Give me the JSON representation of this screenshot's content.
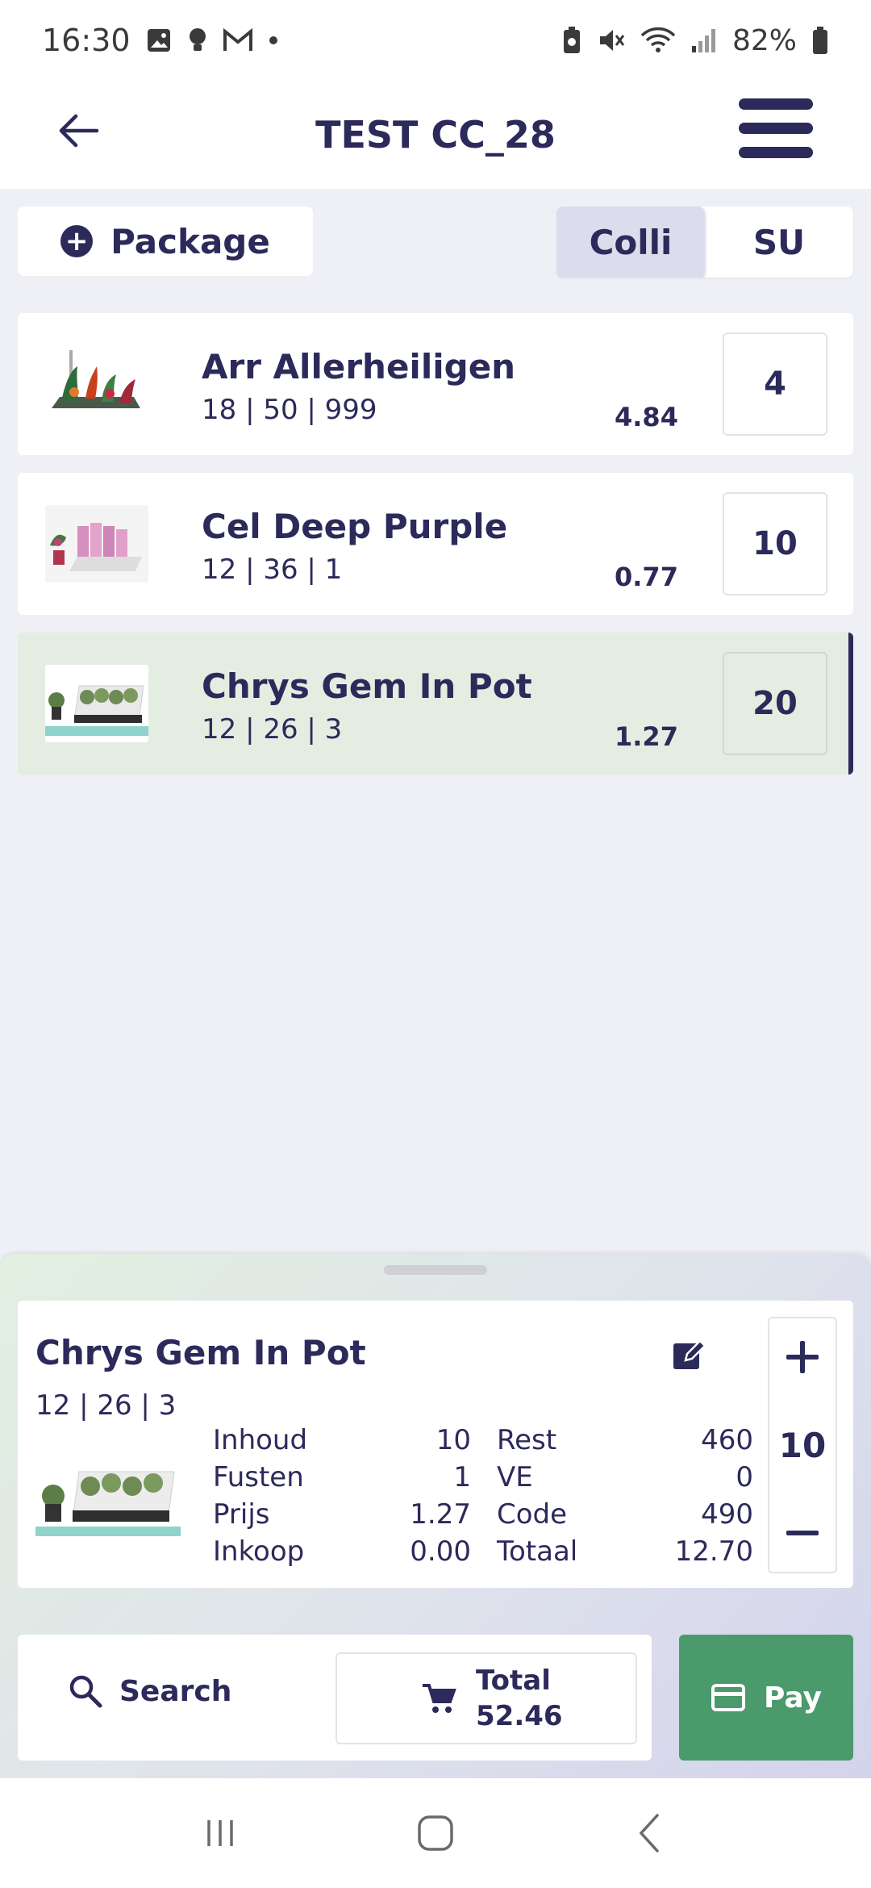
{
  "status_bar": {
    "time": "16:30",
    "battery": "82%",
    "icons": [
      "image-icon",
      "bulb-icon",
      "gmail-icon",
      "dot-icon",
      "battery-saver-icon",
      "mute-icon",
      "wifi-icon",
      "signal-icon",
      "battery-icon"
    ]
  },
  "header": {
    "title": "TEST CC_28"
  },
  "package_button": {
    "label": "Package"
  },
  "unit_toggle": {
    "options": [
      "Colli",
      "SU"
    ],
    "selected": "Colli"
  },
  "products": [
    {
      "name": "Arr Allerheiligen",
      "sub": "18 | 50 | 999",
      "price": "4.84",
      "qty": "4",
      "selected": false
    },
    {
      "name": "Cel Deep Purple",
      "sub": "12 | 36 | 1",
      "price": "0.77",
      "qty": "10",
      "selected": false
    },
    {
      "name": "Chrys Gem In Pot",
      "sub": "12 | 26 | 3",
      "price": "1.27",
      "qty": "20",
      "selected": true
    }
  ],
  "detail": {
    "name": "Chrys Gem In Pot",
    "sub": "12 | 26 | 3",
    "stats": [
      {
        "label": "Inhoud",
        "value": "10",
        "label2": "Rest",
        "value2": "460"
      },
      {
        "label": "Fusten",
        "value": "1",
        "label2": "VE",
        "value2": "0"
      },
      {
        "label": "Prijs",
        "value": "1.27",
        "label2": "Code",
        "value2": "490"
      },
      {
        "label": "Inkoop",
        "value": "0.00",
        "label2": "Totaal",
        "value2": "12.70"
      }
    ],
    "stepper_value": "10"
  },
  "actions": {
    "search_label": "Search",
    "total_label": "Total",
    "total_value": "52.46",
    "pay_label": "Pay"
  },
  "colors": {
    "primary": "#2c2a5a",
    "background": "#eff0f6",
    "selected_row": "#e3ede1",
    "pay": "#4a9a6c"
  }
}
